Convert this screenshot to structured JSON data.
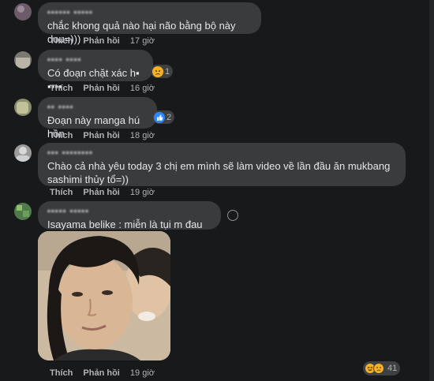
{
  "colors": {
    "background": "#18191a",
    "bubble": "#3a3b3c",
    "muted": "#b0b3b8",
    "like_blue": "#2d88ff",
    "haha_yellow": "#f7b125"
  },
  "actions": {
    "like": "Thích",
    "reply": "Phản hồi"
  },
  "comments": [
    {
      "author": "▪▪▪▪▪▪ ▪▪▪▪▪",
      "text": "chắc khong quả nào hại não bằng bộ này dou=)))",
      "time": "17 giờ"
    },
    {
      "author": "▪▪▪▪ ▪▪▪▪",
      "text": "Có đoạn chặt xác h▪ ▪▪▪▪",
      "time": "16 giờ",
      "reactions": {
        "icons": [
          "sad-icon"
        ],
        "count": "1"
      }
    },
    {
      "author": "▪▪ ▪▪▪▪",
      "text": "Đoạn này manga hú hồn",
      "time": "18 giờ",
      "reactions": {
        "icons": [
          "like-icon"
        ],
        "count": "2"
      }
    },
    {
      "author": "▪▪▪ ▪▪▪▪▪▪▪▪",
      "text": "Chào cả nhà yêu today 3 chị em mình sẽ làm video về lần đầu ăn mukbang sashimi thủy tổ=))",
      "time": "19 giờ"
    },
    {
      "author": "▪▪▪▪▪ ▪▪▪▪▪",
      "text": "Isayama belike : miễn là tụi m đau khổ :))",
      "time": "19 giờ",
      "reactions": {
        "icons": [
          "haha-icon",
          "sad-icon"
        ],
        "count": "41"
      }
    }
  ]
}
